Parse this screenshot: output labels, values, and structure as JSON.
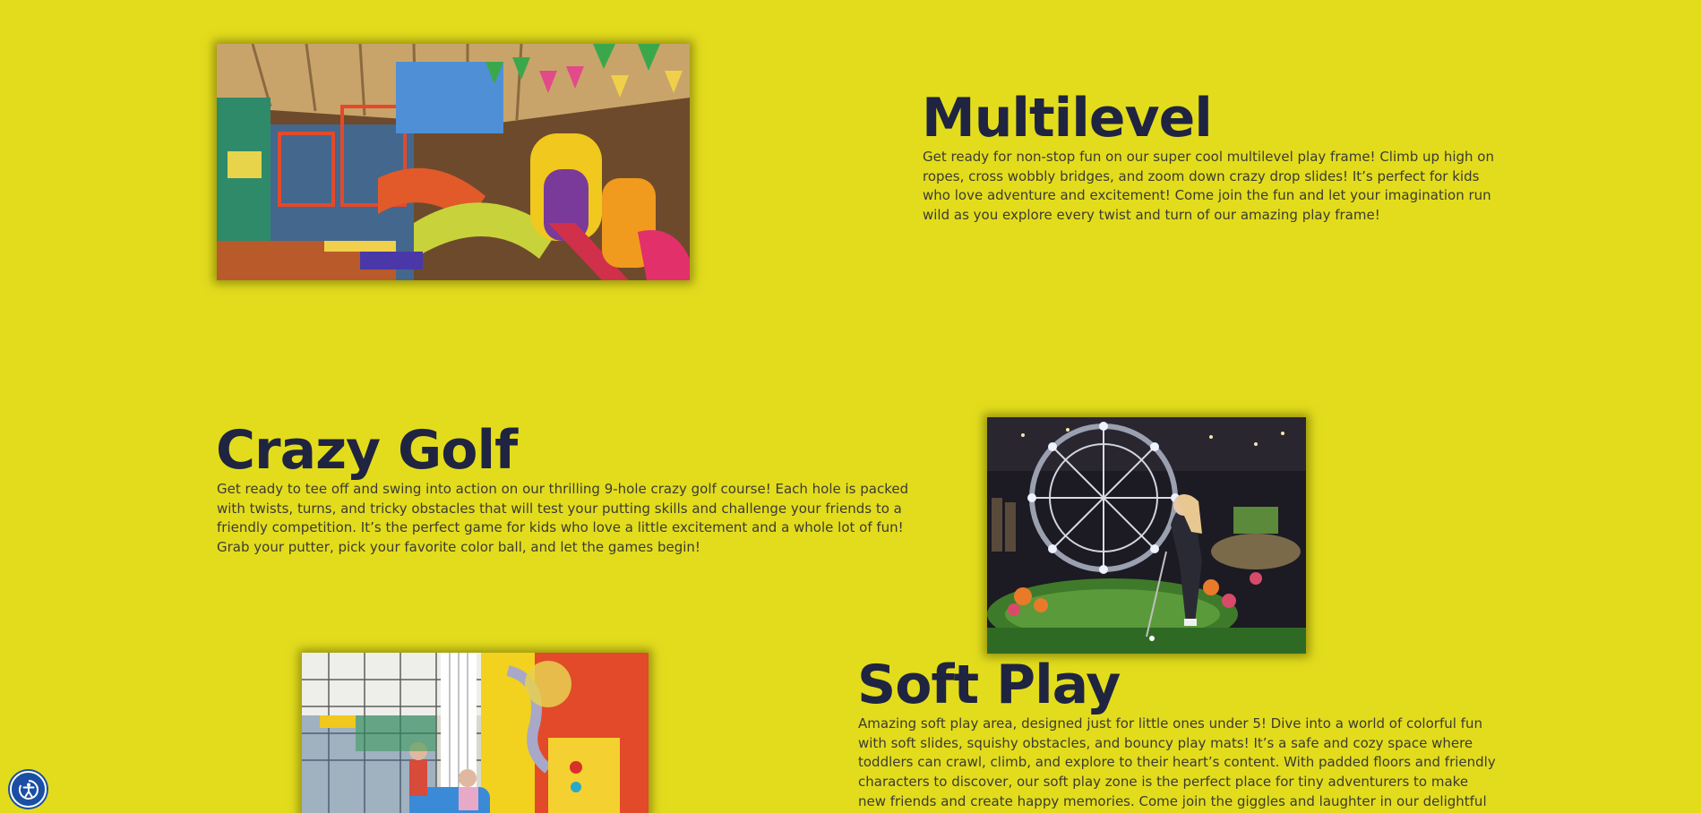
{
  "sections": {
    "multilevel": {
      "title": "Multilevel",
      "description": "Get ready for non-stop fun on our super cool multilevel play frame! Climb up high on ropes, cross wobbly bridges, and zoom down crazy drop slides! It’s perfect for kids who love adventure and excitement! Come join the fun and let your imagination run wild as you explore every twist and turn of our amazing play frame!"
    },
    "crazy_golf": {
      "title": "Crazy Golf",
      "description": "Get ready to tee off and swing into action on our thrilling 9-hole crazy golf course! Each hole is packed with twists, turns, and tricky obstacles that will test your putting skills and challenge your friends to a friendly competition. It’s the perfect game for kids who love a little excitement and a whole lot of fun! Grab your putter, pick your favorite color ball, and let the games begin!"
    },
    "soft_play": {
      "title": "Soft Play",
      "description": "Amazing soft play area, designed just for little ones under 5! Dive into a world of colorful fun with soft slides, squishy obstacles, and bouncy play mats! It’s a safe and cozy space where toddlers can crawl, climb, and explore to their heart’s content. With padded floors and friendly characters to discover, our soft play zone is the perfect place for tiny adventurers to make new friends and create happy memories. Come join the giggles and laughter in our delightful soft play area!"
    }
  },
  "accessibility_button": {
    "icon": "accessibility-icon"
  },
  "colors": {
    "background": "#e3dc1d",
    "heading": "#1f2441",
    "body_text": "#3b3b32",
    "accessibility_button": "#1a4fa3"
  }
}
